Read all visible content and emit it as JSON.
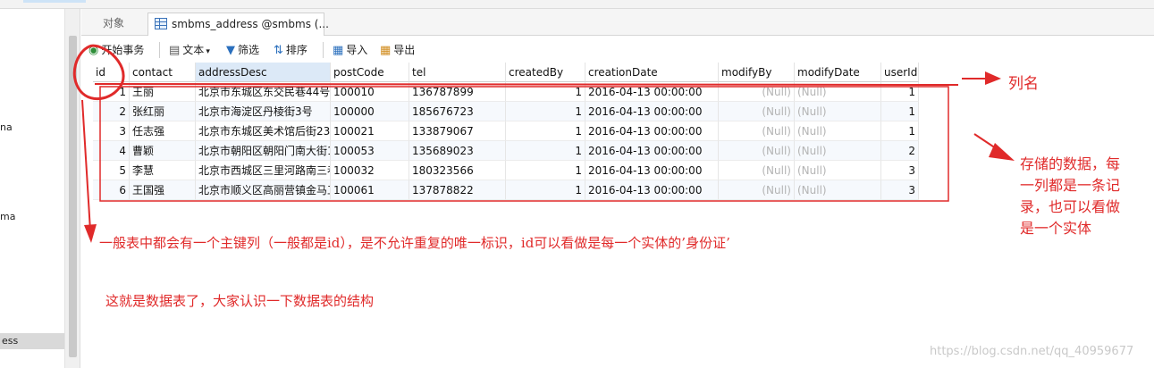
{
  "sidebar": {
    "items": [
      "na",
      "ma",
      "ess"
    ]
  },
  "tabs": {
    "objects": "对象",
    "table": "smbms_address @smbms (..."
  },
  "toolbar": {
    "begin_transaction": "开始事务",
    "text": "文本",
    "filter": "筛选",
    "sort": "排序",
    "import": "导入",
    "export": "导出"
  },
  "table": {
    "columns": [
      "id",
      "contact",
      "addressDesc",
      "postCode",
      "tel",
      "createdBy",
      "creationDate",
      "modifyBy",
      "modifyDate",
      "userId"
    ],
    "rows": [
      [
        "1",
        "王丽",
        "北京市东城区东交民巷44号",
        "100010",
        "136787899",
        "1",
        "2016-04-13 00:00:00",
        "(Null)",
        "(Null)",
        "1"
      ],
      [
        "2",
        "张红丽",
        "北京市海淀区丹棱街3号",
        "100000",
        "185676723",
        "1",
        "2016-04-13 00:00:00",
        "(Null)",
        "(Null)",
        "1"
      ],
      [
        "3",
        "任志强",
        "北京市东城区美术馆后街23",
        "100021",
        "133879067",
        "1",
        "2016-04-13 00:00:00",
        "(Null)",
        "(Null)",
        "1"
      ],
      [
        "4",
        "曹颖",
        "北京市朝阳区朝阳门南大街1",
        "100053",
        "135689023",
        "1",
        "2016-04-13 00:00:00",
        "(Null)",
        "(Null)",
        "2"
      ],
      [
        "5",
        "李慧",
        "北京市西城区三里河路南三巷",
        "100032",
        "180323566",
        "1",
        "2016-04-13 00:00:00",
        "(Null)",
        "(Null)",
        "3"
      ],
      [
        "6",
        "王国强",
        "北京市顺义区高丽营镇金马工",
        "100061",
        "137878822",
        "1",
        "2016-04-13 00:00:00",
        "(Null)",
        "(Null)",
        "3"
      ]
    ]
  },
  "annotations": {
    "column_name": "列名",
    "stored_data_1": "存储的数据，每",
    "stored_data_2": "一列都是一条记",
    "stored_data_3": "录，也可以看做",
    "stored_data_4": "是一个实体",
    "primary_key": "一般表中都会有一个主键列（一般都是id），是不允许重复的唯一标识，id可以看做是每一个实体的’身份证’",
    "summary": "这就是数据表了，大家认识一下数据表的结构",
    "color": "#e02a2a"
  },
  "watermark": "https://blog.csdn.net/qq_40959677"
}
